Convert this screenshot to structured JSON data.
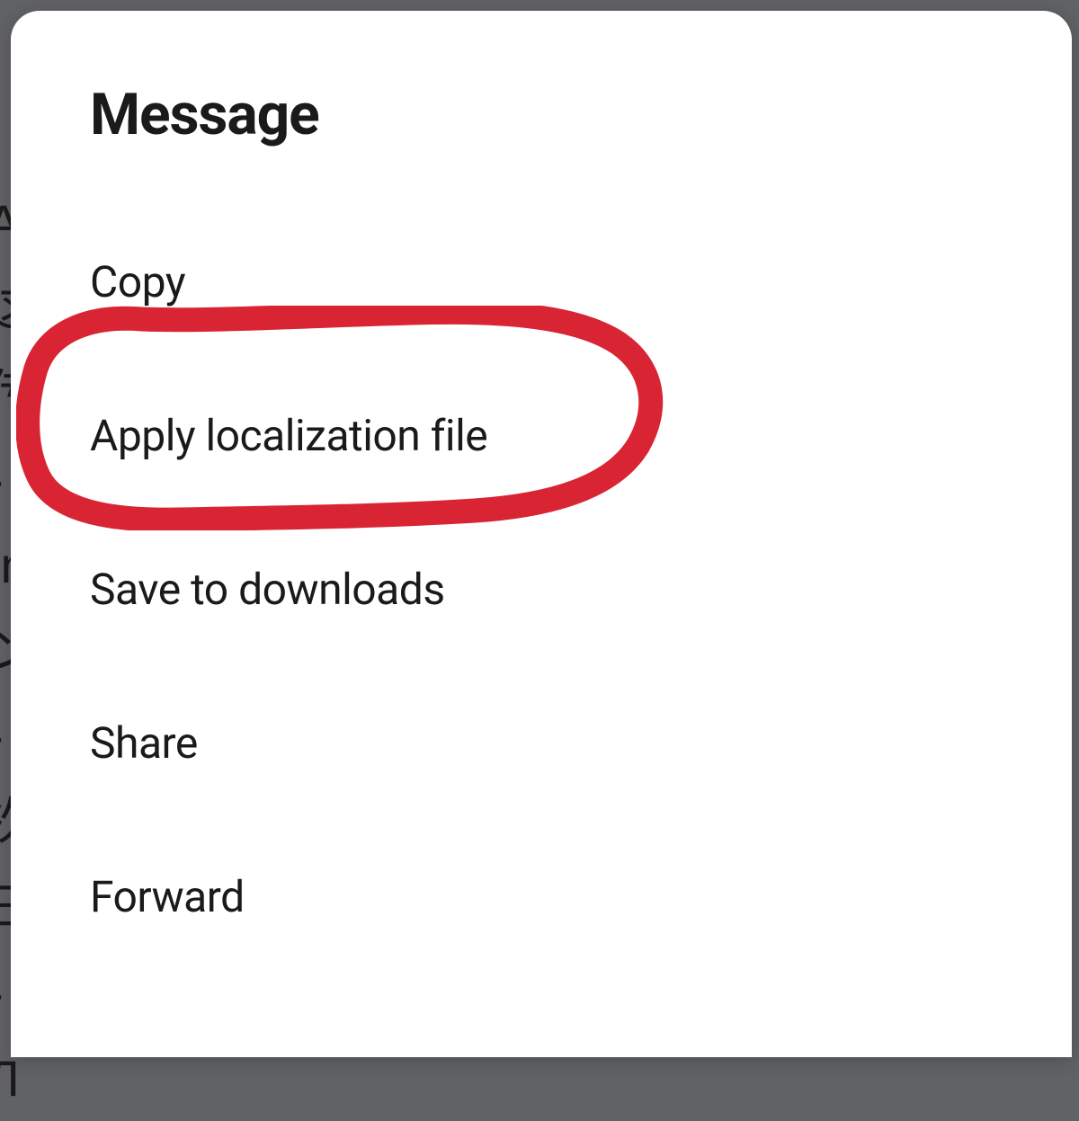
{
  "dialog": {
    "title": "Message",
    "items": [
      {
        "label": "Copy"
      },
      {
        "label": "Apply localization file"
      },
      {
        "label": "Save to downloads"
      },
      {
        "label": "Share"
      },
      {
        "label": "Forward"
      }
    ]
  },
  "annotation": {
    "color": "#d92433",
    "highlighted_item_index": 1
  },
  "background_partial_text": "A\n这\n传\n-\nIn\nン\n-\n次\n日\n-\nЛ"
}
